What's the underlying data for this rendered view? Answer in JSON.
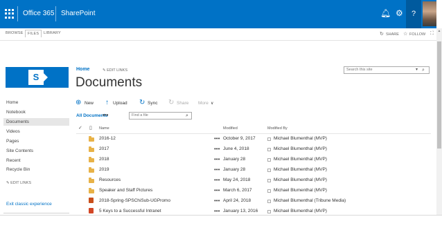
{
  "suite": {
    "product": "Office 365",
    "app": "SharePoint",
    "help": "?",
    "brand_color": "#0072c6"
  },
  "ribbon": {
    "tabs": [
      "BROWSE",
      "FILES",
      "LIBRARY"
    ],
    "share": "SHARE",
    "follow": "FOLLOW"
  },
  "nav": {
    "items": [
      "Home",
      "Notebook",
      "Documents",
      "Videos",
      "Pages",
      "Site Contents",
      "Recent",
      "Recycle Bin"
    ],
    "selected": "Documents",
    "edit_links": "EDIT LINKS",
    "exit_classic": "Exit classic experience"
  },
  "breadcrumb": {
    "home": "Home",
    "edit_links": "EDIT LINKS"
  },
  "title": "Documents",
  "search": {
    "placeholder": "Search this site"
  },
  "commands": {
    "new": "New",
    "upload": "Upload",
    "sync": "Sync",
    "share": "Share",
    "more": "More"
  },
  "view": {
    "name": "All Documents",
    "dots": "•••",
    "find_placeholder": "Find a file"
  },
  "table": {
    "headers": {
      "name": "Name",
      "modified": "Modified",
      "modified_by": "Modified By"
    },
    "rows": [
      {
        "type": "folder",
        "name": "2016-12",
        "modified": "October 9, 2017",
        "modified_by": "Michael Blumenthal (MVP)"
      },
      {
        "type": "folder",
        "name": "2017",
        "modified": "June 4, 2018",
        "modified_by": "Michael Blumenthal (MVP)"
      },
      {
        "type": "folder",
        "name": "2018",
        "modified": "January 28",
        "modified_by": "Michael Blumenthal (MVP)"
      },
      {
        "type": "folder",
        "name": "2019",
        "modified": "January 28",
        "modified_by": "Michael Blumenthal (MVP)"
      },
      {
        "type": "folder",
        "name": "Resources",
        "modified": "May 24, 2018",
        "modified_by": "Michael Blumenthal (MVP)"
      },
      {
        "type": "folder",
        "name": "Speaker and Staff Pictures",
        "modified": "March 6, 2017",
        "modified_by": "Michael Blumenthal (MVP)"
      },
      {
        "type": "ppt",
        "name": "2018-Spring-SPSChiSub-UGPromo",
        "modified": "April 24, 2018",
        "modified_by": "Michael Blumenthal (Tribune Media)"
      },
      {
        "type": "ppt",
        "name": "5 Keys to a Successful Intranet",
        "modified": "January 13, 2016",
        "modified_by": "Michael Blumenthal (MVP)"
      }
    ],
    "row_dots": "•••"
  }
}
